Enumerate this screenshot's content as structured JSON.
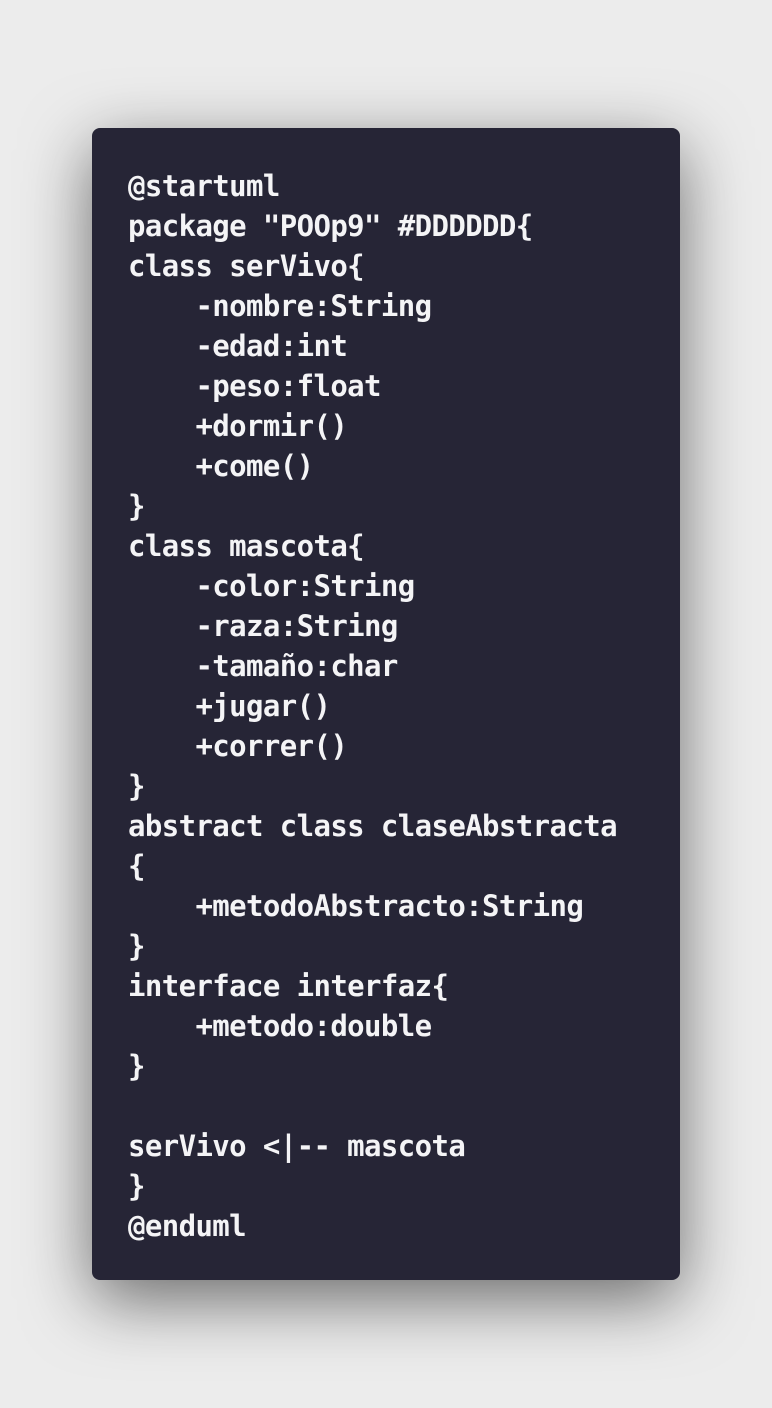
{
  "code": {
    "lines": [
      "@startuml",
      "package \"POOp9\" #DDDDDD{",
      "class serVivo{",
      "    -nombre:String",
      "    -edad:int",
      "    -peso:float",
      "    +dormir()",
      "    +come()",
      "}",
      "class mascota{",
      "    -color:String",
      "    -raza:String",
      "    -tamaño:char",
      "    +jugar()",
      "    +correr()",
      "}",
      "abstract class claseAbstracta",
      "{",
      "    +metodoAbstracto:String",
      "}",
      "interface interfaz{",
      "    +metodo:double",
      "}",
      "",
      "serVivo <|-- mascota",
      "}",
      "@enduml"
    ]
  },
  "colors": {
    "page_background": "#ececec",
    "code_background": "#262536",
    "code_text": "#f4f4f6"
  }
}
